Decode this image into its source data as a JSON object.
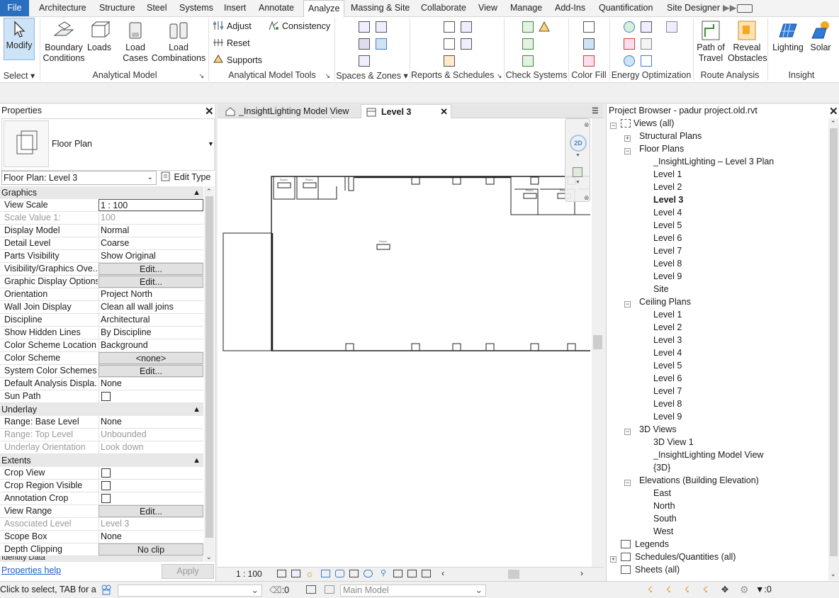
{
  "menu": {
    "items": [
      "File",
      "Architecture",
      "Structure",
      "Steel",
      "Systems",
      "Insert",
      "Annotate",
      "Analyze",
      "Massing & Site",
      "Collaborate",
      "View",
      "Manage",
      "Add-Ins",
      "Quantification",
      "Site Designer"
    ],
    "active": "Analyze"
  },
  "ribbon": {
    "select": {
      "modify": "Modify",
      "label": "Select"
    },
    "analytical_model": {
      "boundary": "Boundary Conditions",
      "loads": "Loads",
      "load_cases": "Load Cases",
      "load_combinations": "Load Combinations",
      "label": "Analytical Model"
    },
    "tools": {
      "adjust": "Adjust",
      "reset": "Reset",
      "supports": "Supports",
      "consistency": "Consistency",
      "label": "Analytical Model Tools"
    },
    "spaces_label": "Spaces & Zones",
    "reports_label": "Reports & Schedules",
    "check_label": "Check Systems",
    "colorfill_label": "Color Fill",
    "energy_label": "Energy Optimization",
    "route": {
      "path_of_travel": "Path of Travel",
      "reveal_obstacles": "Reveal Obstacles",
      "label": "Route Analysis"
    },
    "insight": {
      "lighting": "Lighting",
      "solar": "Solar",
      "label": "Insight"
    }
  },
  "properties": {
    "title": "Properties",
    "type_name": "Floor Plan",
    "instance_selector": "Floor Plan: Level 3",
    "edit_type": "Edit Type",
    "groups": {
      "graphics": "Graphics",
      "underlay": "Underlay",
      "extents": "Extents",
      "identity": "Identity Data"
    },
    "rows": {
      "view_scale": {
        "name": "View Scale",
        "value": "1 : 100"
      },
      "scale_value": {
        "name": "Scale Value    1:",
        "value": "100"
      },
      "display_model": {
        "name": "Display Model",
        "value": "Normal"
      },
      "detail_level": {
        "name": "Detail Level",
        "value": "Coarse"
      },
      "parts_visibility": {
        "name": "Parts Visibility",
        "value": "Show Original"
      },
      "vg_overrides": {
        "name": "Visibility/Graphics Ove...",
        "value": "Edit..."
      },
      "gdo": {
        "name": "Graphic Display Options",
        "value": "Edit..."
      },
      "orientation": {
        "name": "Orientation",
        "value": "Project North"
      },
      "wall_join": {
        "name": "Wall Join Display",
        "value": "Clean all wall joins"
      },
      "discipline": {
        "name": "Discipline",
        "value": "Architectural"
      },
      "hidden_lines": {
        "name": "Show Hidden Lines",
        "value": "By Discipline"
      },
      "cs_location": {
        "name": "Color Scheme Location",
        "value": "Background"
      },
      "color_scheme": {
        "name": "Color Scheme",
        "value": "<none>"
      },
      "sys_color": {
        "name": "System Color Schemes",
        "value": "Edit..."
      },
      "default_analysis": {
        "name": "Default Analysis Displa...",
        "value": "None"
      },
      "sun_path": {
        "name": "Sun Path",
        "value": ""
      },
      "base_level": {
        "name": "Range: Base Level",
        "value": "None"
      },
      "top_level": {
        "name": "Range: Top Level",
        "value": "Unbounded"
      },
      "underlay_orient": {
        "name": "Underlay Orientation",
        "value": "Look down"
      },
      "crop_view": {
        "name": "Crop View",
        "value": ""
      },
      "crop_region": {
        "name": "Crop Region Visible",
        "value": ""
      },
      "annotation_crop": {
        "name": "Annotation Crop",
        "value": ""
      },
      "view_range": {
        "name": "View Range",
        "value": "Edit..."
      },
      "assoc_level": {
        "name": "Associated Level",
        "value": "Level 3"
      },
      "scope_box": {
        "name": "Scope Box",
        "value": "None"
      },
      "depth_clipping": {
        "name": "Depth Clipping",
        "value": "No clip"
      }
    },
    "help": "Properties help",
    "apply": "Apply"
  },
  "view_tabs": {
    "tab1": "_InsightLighting Model View",
    "tab2": "Level 3"
  },
  "view_control": {
    "scale": "1 : 100"
  },
  "browser": {
    "title": "Project Browser - padur project.old.rvt",
    "views_all": "Views (all)",
    "structural_plans": "Structural Plans",
    "floor_plans": "Floor Plans",
    "floor_items": [
      "_InsightLighting – Level 3 Plan",
      "Level 1",
      "Level 2",
      "Level 3",
      "Level 4",
      "Level 5",
      "Level 6",
      "Level 7",
      "Level 8",
      "Level 9",
      "Site"
    ],
    "ceiling_plans": "Ceiling Plans",
    "ceiling_items": [
      "Level 1",
      "Level 2",
      "Level 3",
      "Level 4",
      "Level 5",
      "Level 6",
      "Level 7",
      "Level 8",
      "Level 9"
    ],
    "views_3d": "3D Views",
    "items_3d": [
      "3D View 1",
      "_InsightLighting Model View",
      "{3D}"
    ],
    "elevations": "Elevations (Building Elevation)",
    "elev_items": [
      "East",
      "North",
      "South",
      "West"
    ],
    "legends": "Legends",
    "schedules": "Schedules/Quantities (all)",
    "sheets": "Sheets (all)"
  },
  "status": {
    "hint": "Click to select, TAB for alte",
    "worksets": ":0",
    "model": "Main Model",
    "filter_count": ":0"
  }
}
